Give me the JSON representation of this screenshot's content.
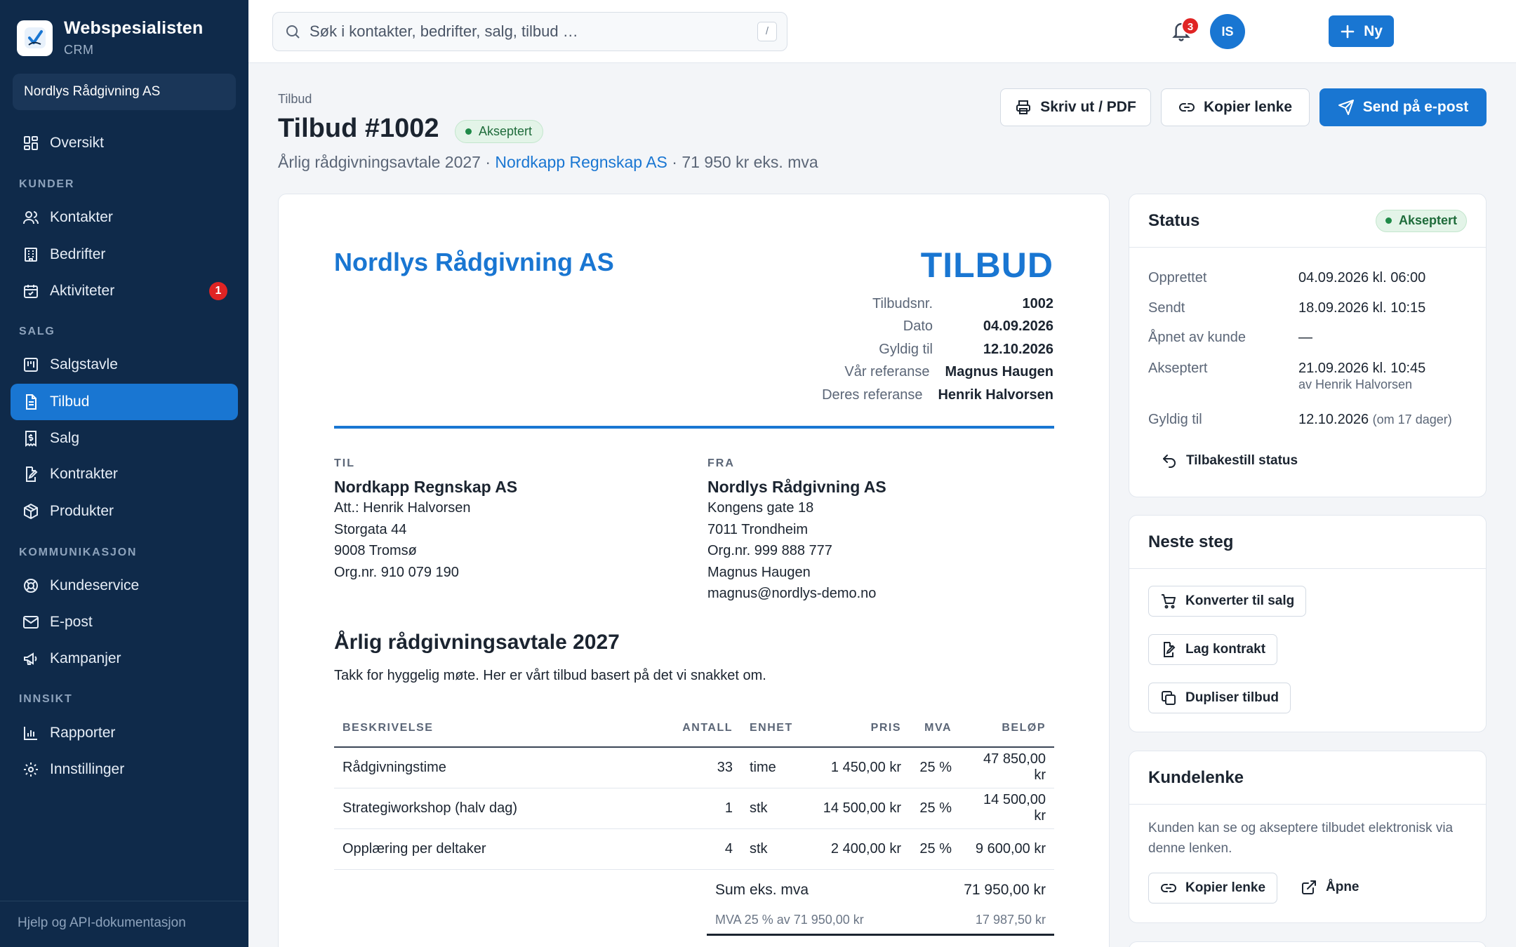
{
  "brand": {
    "name": "Webspesialisten",
    "sub": "CRM"
  },
  "org": "Nordlys Rådgivning AS",
  "nav": {
    "overview": "Oversikt",
    "sec_customers": "KUNDER",
    "contacts": "Kontakter",
    "companies": "Bedrifter",
    "activities": "Aktiviteter",
    "activities_badge": "1",
    "sec_sales": "SALG",
    "pipeline": "Salgstavle",
    "quotes": "Tilbud",
    "sales": "Salg",
    "contracts": "Kontrakter",
    "products": "Produkter",
    "sec_comm": "KOMMUNIKASJON",
    "support": "Kundeservice",
    "email": "E-post",
    "campaigns": "Kampanjer",
    "sec_insight": "INNSIKT",
    "reports": "Rapporter",
    "settings": "Innstillinger",
    "footer": "Hjelp og API-dokumentasjon"
  },
  "topbar": {
    "search_placeholder": "Søk i kontakter, bedrifter, salg, tilbud …",
    "shortcut": "/",
    "new_label": "Ny",
    "notif_count": "3",
    "avatar_initials": "IS"
  },
  "header": {
    "breadcrumb": "Tilbud",
    "title": "Tilbud #1002",
    "status": "Akseptert",
    "subtitle_prefix": "Årlig rådgivningsavtale 2027 · ",
    "customer": "Nordkapp Regnskap AS",
    "subtitle_suffix": " · 71 950 kr eks. mva",
    "print": "Skriv ut / PDF",
    "copy_link": "Kopier lenke",
    "send_email": "Send på e-post"
  },
  "doc": {
    "company": "Nordlys Rådgivning AS",
    "kind": "TILBUD",
    "meta": [
      {
        "k": "Tilbudsnr.",
        "v": "1002"
      },
      {
        "k": "Dato",
        "v": "04.09.2026"
      },
      {
        "k": "Gyldig til",
        "v": "12.10.2026"
      },
      {
        "k": "Vår referanse",
        "v": "Magnus Haugen"
      },
      {
        "k": "Deres referanse",
        "v": "Henrik Halvorsen"
      }
    ],
    "to": {
      "label": "TIL",
      "name": "Nordkapp Regnskap AS",
      "lines": [
        "Att.: Henrik Halvorsen",
        "Storgata 44",
        "9008 Tromsø",
        "Org.nr. 910 079 190"
      ]
    },
    "from": {
      "label": "FRA",
      "name": "Nordlys Rådgivning AS",
      "lines": [
        "Kongens gate 18",
        "7011 Trondheim",
        "Org.nr. 999 888 777",
        "Magnus Haugen",
        "magnus@nordlys-demo.no"
      ]
    },
    "heading": "Årlig rådgivningsavtale 2027",
    "intro": "Takk for hyggelig møte. Her er vårt tilbud basert på det vi snakket om.",
    "columns": [
      "BESKRIVELSE",
      "ANTALL",
      "ENHET",
      "PRIS",
      "MVA",
      "BELØP"
    ],
    "rows": [
      [
        "Rådgivningstime",
        "33",
        "time",
        "1 450,00 kr",
        "25 %",
        "47 850,00 kr"
      ],
      [
        "Strategiworkshop (halv dag)",
        "1",
        "stk",
        "14 500,00 kr",
        "25 %",
        "14 500,00 kr"
      ],
      [
        "Opplæring per deltaker",
        "4",
        "stk",
        "2 400,00 kr",
        "25 %",
        "9 600,00 kr"
      ]
    ],
    "sum_label": "Sum eks. mva",
    "sum_value": "71 950,00 kr",
    "vat_label": "MVA 25 % av 71 950,00 kr",
    "vat_value": "17 987,50 kr"
  },
  "status_card": {
    "title": "Status",
    "badge": "Akseptert",
    "created_k": "Opprettet",
    "created_v": "04.09.2026 kl. 06:00",
    "sent_k": "Sendt",
    "sent_v": "18.09.2026 kl. 10:15",
    "opened_k": "Åpnet av kunde",
    "opened_v": "—",
    "accepted_k": "Akseptert",
    "accepted_v": "21.09.2026 kl. 10:45",
    "accepted_by": "av Henrik Halvorsen",
    "valid_k": "Gyldig til",
    "valid_v": "12.10.2026",
    "valid_note": "(om 17 dager)",
    "reset": "Tilbakestill status"
  },
  "next_card": {
    "title": "Neste steg",
    "convert": "Konverter til salg",
    "contract": "Lag kontrakt",
    "duplicate": "Dupliser tilbud"
  },
  "link_card": {
    "title": "Kundelenke",
    "text": "Kunden kan se og akseptere tilbudet elektronisk via denne lenken.",
    "copy": "Kopier lenke",
    "open": "Åpne"
  },
  "colors": {
    "primary": "#1976d2",
    "sidebar": "#0f2a4a",
    "success": "#1f8a48",
    "danger": "#e02424"
  }
}
